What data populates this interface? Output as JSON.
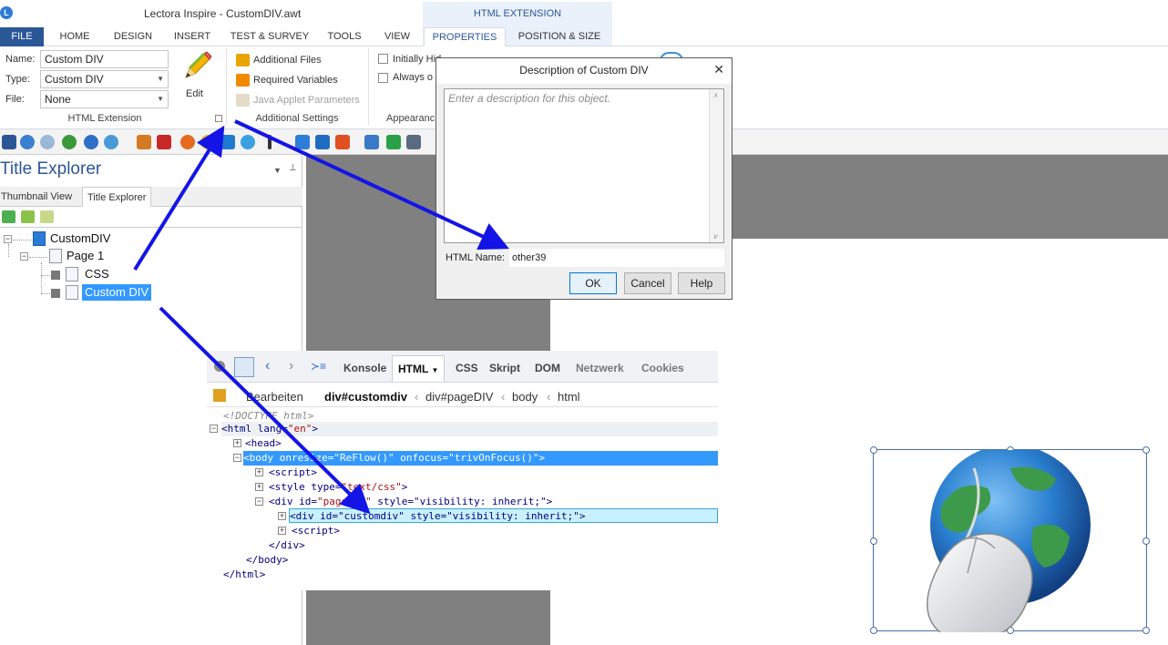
{
  "window": {
    "title": "Lectora Inspire - CustomDIV.awt",
    "context_group": "HTML EXTENSION"
  },
  "ribbon_tabs": [
    "FILE",
    "HOME",
    "DESIGN",
    "INSERT",
    "TEST & SURVEY",
    "TOOLS",
    "VIEW",
    "PROPERTIES",
    "POSITION & SIZE"
  ],
  "properties": {
    "name_label": "Name:",
    "name_value": "Custom DIV",
    "type_label": "Type:",
    "type_value": "Custom DIV",
    "file_label": "File:",
    "file_value": "None",
    "edit_label": "Edit",
    "group_html_extension": "HTML Extension",
    "additional_files": "Additional Files",
    "required_variables": "Required Variables",
    "java_applet_parameters": "Java Applet Parameters",
    "group_additional_settings": "Additional Settings",
    "initially_hidden": "Initially Hid",
    "always_on_top": "Always o",
    "group_appearance": "Appearanc"
  },
  "explorer": {
    "title": "Title Explorer",
    "tabs": [
      "Thumbnail View",
      "Title Explorer"
    ],
    "tree": [
      {
        "label": "CustomDIV"
      },
      {
        "label": "Page 1"
      },
      {
        "label": "CSS"
      },
      {
        "label": "Custom DIV"
      }
    ]
  },
  "dialog": {
    "title": "Description of Custom DIV",
    "placeholder": "Enter a description for this object.",
    "html_name_label": "HTML Name:",
    "html_name_value": "other39",
    "ok": "OK",
    "cancel": "Cancel",
    "help": "Help"
  },
  "devtools": {
    "tabs": [
      "Konsole",
      "HTML",
      "CSS",
      "Skript",
      "DOM",
      "Netzwerk",
      "Cookies"
    ],
    "crumbs": [
      "Bearbeiten",
      "div#customdiv",
      "div#pageDIV",
      "body",
      "html"
    ],
    "code": [
      {
        "text": "<!DOCTYPE html>"
      },
      {
        "pre": "<html lang=",
        "str": "\"en\"",
        "post": ">"
      },
      {
        "text": "<head>"
      },
      {
        "pre": "<body onresize=",
        "str": "\"ReFlow()\"",
        "post": " onfocus=\"trivOnFocus()\">"
      },
      {
        "text": "<script>"
      },
      {
        "pre": "<style type=",
        "str": "\"text/css\"",
        "post": ">"
      },
      {
        "pre": "<div id=",
        "str": "\"pageDIV\"",
        "post": " style=\"visibility: inherit;\">"
      },
      {
        "text": "<div id=\"customdiv\" style=\"visibility: inherit;\">"
      },
      {
        "text": "<script>"
      },
      {
        "text": "</div>"
      },
      {
        "text": "</body>"
      },
      {
        "text": "</html>"
      }
    ]
  },
  "icons": [
    "pencil-icon",
    "globe-mouse-icon"
  ],
  "colors": {
    "accent": "#2b5797",
    "selection": "#3399ff",
    "arrow": "#1414e6",
    "canvas_gray": "#808080"
  }
}
